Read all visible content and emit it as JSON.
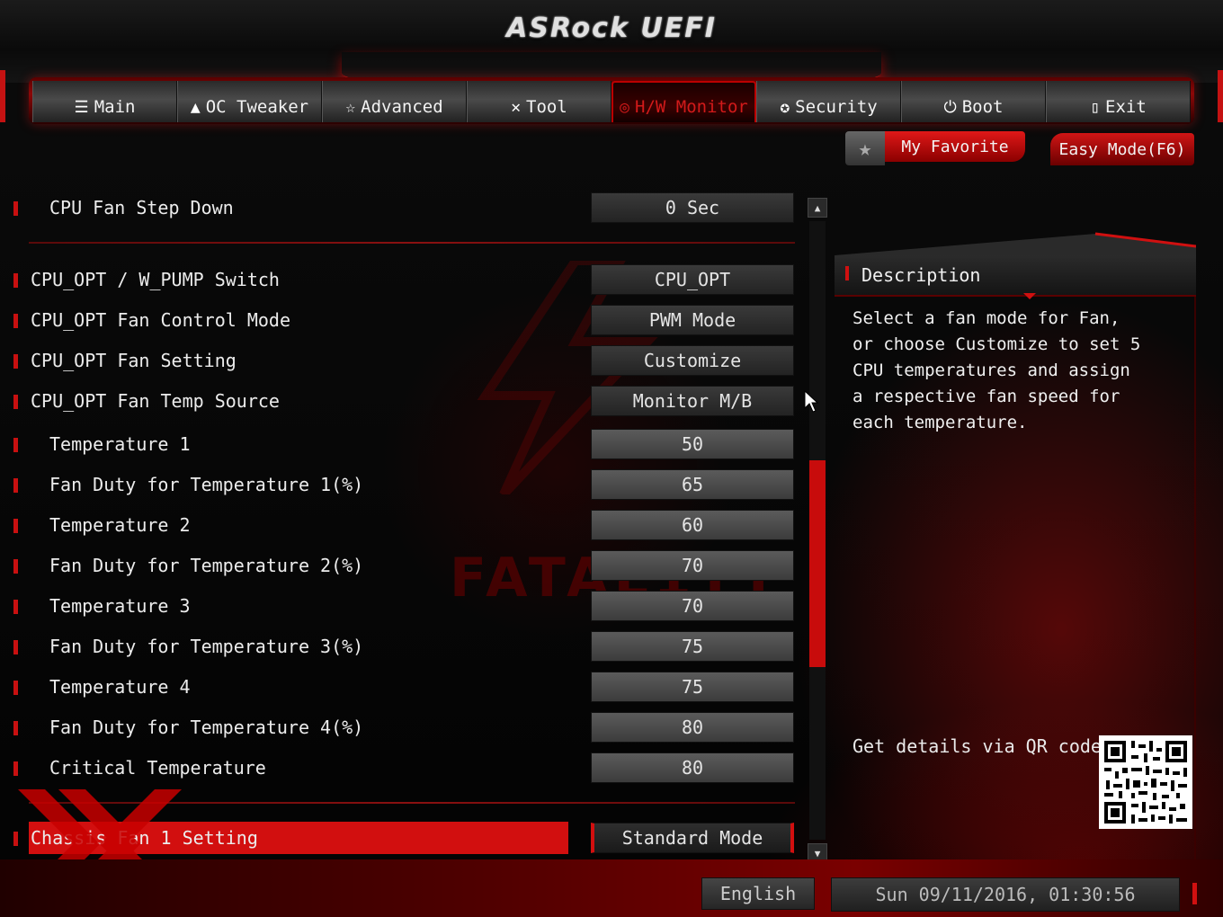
{
  "header": {
    "logo_text": "ASRock UEFI"
  },
  "tabs": [
    {
      "label": "Main",
      "icon": "list-icon"
    },
    {
      "label": "OC Tweaker",
      "icon": "rocket-icon"
    },
    {
      "label": "Advanced",
      "icon": "star-icon"
    },
    {
      "label": "Tool",
      "icon": "tools-icon"
    },
    {
      "label": "H/W Monitor",
      "icon": "monitor-icon",
      "active": true
    },
    {
      "label": "Security",
      "icon": "shield-icon"
    },
    {
      "label": "Boot",
      "icon": "power-icon"
    },
    {
      "label": "Exit",
      "icon": "exit-door-icon"
    }
  ],
  "favorite": {
    "label": "My Favorite"
  },
  "easy_mode": {
    "label": "Easy Mode(F6)"
  },
  "settings": [
    {
      "label": "CPU Fan Step Down",
      "value": "0 Sec"
    },
    {
      "label": "CPU_OPT / W_PUMP Switch",
      "value": "CPU_OPT"
    },
    {
      "label": "CPU_OPT Fan Control Mode",
      "value": "PWM Mode"
    },
    {
      "label": "CPU_OPT Fan Setting",
      "value": "Customize"
    },
    {
      "label": "CPU_OPT Fan Temp Source",
      "value": "Monitor M/B"
    },
    {
      "label": "Temperature 1",
      "value": "50"
    },
    {
      "label": "Fan Duty for Temperature 1(%)",
      "value": "65"
    },
    {
      "label": "Temperature 2",
      "value": "60"
    },
    {
      "label": "Fan Duty for Temperature 2(%)",
      "value": "70"
    },
    {
      "label": "Temperature 3",
      "value": "70"
    },
    {
      "label": "Fan Duty for Temperature 3(%)",
      "value": "75"
    },
    {
      "label": "Temperature 4",
      "value": "75"
    },
    {
      "label": "Fan Duty for Temperature 4(%)",
      "value": "80"
    },
    {
      "label": "Critical Temperature",
      "value": "80"
    },
    {
      "label": "Chassis Fan 1 Setting",
      "value": "Standard Mode",
      "selected": true
    }
  ],
  "watermark": {
    "text": "FATAL1TY"
  },
  "description": {
    "title": "Description",
    "text": "Select a fan mode for Fan, or choose Customize to set 5 CPU temperatures and assign a respective fan speed for each temperature.",
    "qr_label": "Get details via QR code"
  },
  "footer": {
    "language": "English",
    "datetime": "Sun 09/11/2016, 01:30:56"
  },
  "colors": {
    "accent": "#d20f0f",
    "background": "#050505",
    "text": "#ececec"
  }
}
